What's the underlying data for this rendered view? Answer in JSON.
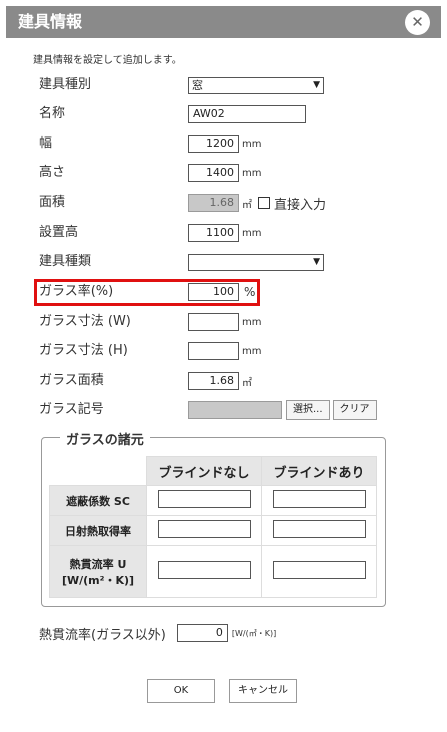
{
  "title": "建具情報",
  "close_glyph": "✕",
  "subtitle": "建具情報を設定して追加します。",
  "fields": {
    "type": {
      "label": "建具種別",
      "value": "窓"
    },
    "name": {
      "label": "名称",
      "value": "AW02"
    },
    "width": {
      "label": "幅",
      "value": "1200",
      "unit": "mm"
    },
    "height": {
      "label": "高さ",
      "value": "1400",
      "unit": "mm"
    },
    "area": {
      "label": "面積",
      "value": "1.68",
      "unit": "㎡",
      "checkbox_label": "直接入力"
    },
    "install_h": {
      "label": "設置高",
      "value": "1100",
      "unit": "mm"
    },
    "kind": {
      "label": "建具種類",
      "value": ""
    },
    "glass_rate": {
      "label": "ガラス率(%)",
      "value": "100",
      "unit": "%"
    },
    "glass_w": {
      "label": "ガラス寸法 (W)",
      "value": "",
      "unit": "mm"
    },
    "glass_h": {
      "label": "ガラス寸法 (H)",
      "value": "",
      "unit": "mm"
    },
    "glass_area": {
      "label": "ガラス面積",
      "value": "1.68",
      "unit": "㎡"
    },
    "glass_code": {
      "label": "ガラス記号",
      "value": "",
      "select_label": "選択...",
      "clear_label": "クリア"
    }
  },
  "glass_group": {
    "legend": "ガラスの諸元",
    "col_blind_none": "ブラインドなし",
    "col_blind_yes": "ブラインドあり",
    "row_sc": "遮蔽係数 SC",
    "row_solar": "日射熱取得率",
    "row_u_line1": "熱貫流率 U",
    "row_u_line2": "[W/(m²・K)]"
  },
  "other_u": {
    "label": "熱貫流率(ガラス以外)",
    "value": "0",
    "unit": "[W/(㎡・K)]"
  },
  "buttons": {
    "ok": "OK",
    "cancel": "キャンセル"
  },
  "colors": {
    "titlebar": "#8a8a8a",
    "highlight": "#e01010"
  }
}
